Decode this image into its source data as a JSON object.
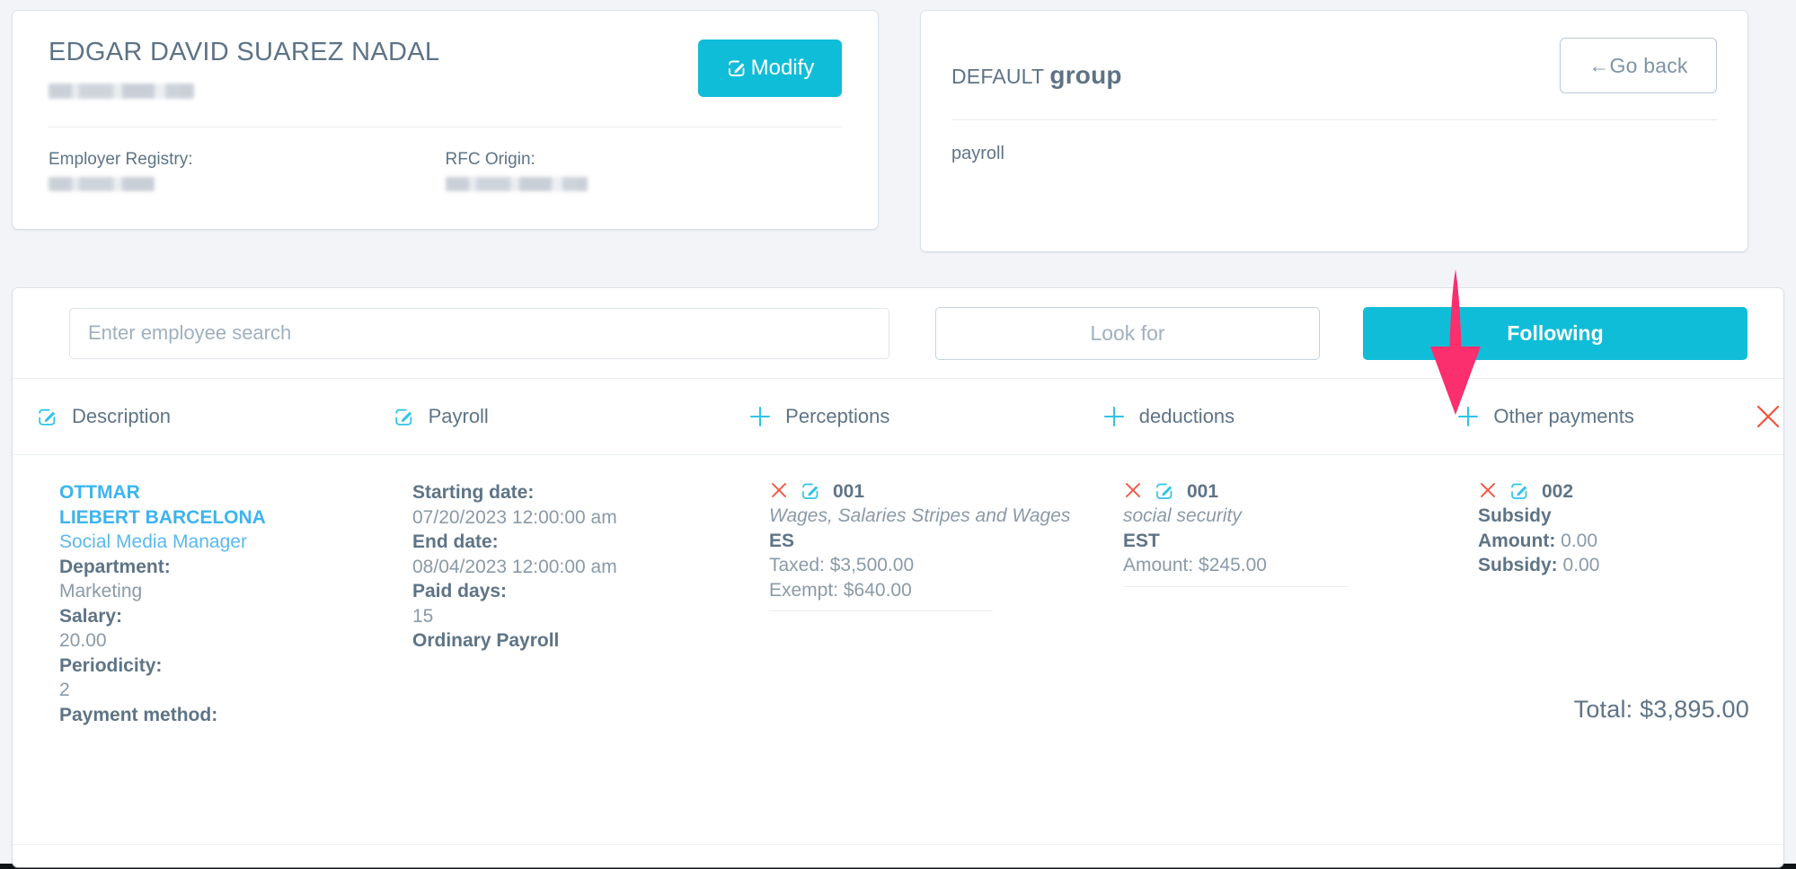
{
  "employee_card": {
    "name": "EDGAR DAVID SUAREZ NADAL",
    "subtitle_redacted": "",
    "modify_label": "Modify",
    "modify_icon": "edit-pencil-icon",
    "fields": [
      {
        "label": "Employer Registry:",
        "value_redacted": ""
      },
      {
        "label": "RFC Origin:",
        "value_redacted": ""
      }
    ]
  },
  "group_card": {
    "title_prefix": "DEFAULT ",
    "title_bold": "group",
    "go_back_label": "←Go back",
    "body": "payroll"
  },
  "toolbar": {
    "search_placeholder": "Enter employee search",
    "search_value": "",
    "look_for_label": "Look for",
    "following_label": "Following"
  },
  "columns": [
    {
      "icon": "edit-pencil-icon",
      "label": "Description"
    },
    {
      "icon": "edit-pencil-icon",
      "label": "Payroll"
    },
    {
      "icon": "plus-icon",
      "label": "Perceptions"
    },
    {
      "icon": "plus-icon",
      "label": "deductions"
    },
    {
      "icon": "plus-icon",
      "label": "Other payments"
    }
  ],
  "close_icon": "close-x-icon",
  "description": {
    "name_line1": "OTTMAR",
    "name_line2": "LIEBERT BARCELONA",
    "role": "Social Media Manager",
    "department_label": "Department:",
    "department_value": "Marketing",
    "salary_label": "Salary:",
    "salary_value": "20.00",
    "periodicity_label": "Periodicity:",
    "periodicity_value": "2",
    "payment_method_label": "Payment method:"
  },
  "payroll": {
    "starting_date_label": "Starting date:",
    "starting_date_value": "07/20/2023 12:00:00 am",
    "end_date_label": "End date:",
    "end_date_value": "08/04/2023 12:00:00 am",
    "paid_days_label": "Paid days:",
    "paid_days_value": "15",
    "type": "Ordinary Payroll"
  },
  "perceptions": {
    "code": "001",
    "description": "Wages, Salaries Stripes and Wages",
    "key": "ES",
    "taxed": "Taxed: $3,500.00",
    "exempt": "Exempt: $640.00"
  },
  "deductions": {
    "code": "001",
    "description": "social security",
    "key": "EST",
    "amount": "Amount: $245.00"
  },
  "other_payments": {
    "code": "002",
    "description": "Subsidy",
    "amount_label": "Amount:",
    "amount_value": "0.00",
    "subsidy_label": "Subsidy:",
    "subsidy_value": "0.00"
  },
  "total": {
    "label": "Total:",
    "value": "$3,895.00"
  },
  "annotation": {
    "type": "down-arrow",
    "color": "#FB2E6E",
    "points_to": "Following"
  },
  "colors": {
    "accent": "#10BDD8",
    "link": "#3CB4F0",
    "text": "#5E7486",
    "muted": "#8A9AA8",
    "danger": "#F4523B",
    "page_bg": "#F2F4F7"
  }
}
